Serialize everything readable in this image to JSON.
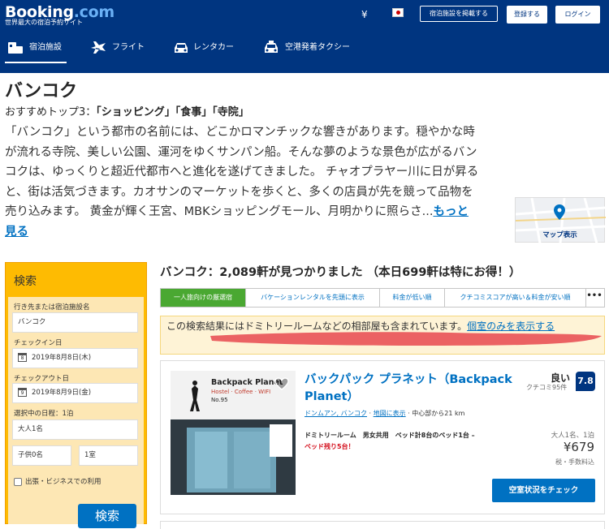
{
  "header": {
    "logo_main": "Booking",
    "logo_suffix": ".com",
    "tagline": "世界最大の宿泊予約サイト",
    "currency": "¥",
    "list_property_label": "宿泊施設を掲載する",
    "register_label": "登録する",
    "login_label": "ログイン",
    "nav": [
      {
        "label": "宿泊施設",
        "icon": "bed-icon",
        "active": true
      },
      {
        "label": "フライト",
        "icon": "plane-icon",
        "active": false
      },
      {
        "label": "レンタカー",
        "icon": "car-icon",
        "active": false
      },
      {
        "label": "空港発着タクシー",
        "icon": "taxi-icon",
        "active": false
      }
    ]
  },
  "intro": {
    "city": "バンコク",
    "top3_prefix": "おすすめトップ3：",
    "top3_items": "「ショッピング」「食事」「寺院」",
    "description": "「バンコク」という都市の名前には、どこかロマンチックな響きがあります。穏やかな時が流れる寺院、美しい公園、運河をゆくサンパン船。そんな夢のような景色が広がるバンコクは、ゆっくりと超近代都市へと進化を遂げてきました。 チャオプラヤー川に日が昇ると、街は活気づきます。カオサンのマーケットを歩くと、多くの店員が先を競って品物を売り込みます。 黄金が輝く王宮、MBKショッピングモール、月明かりに照らさ...",
    "more_link": "もっと見る",
    "map_label": "マップ表示"
  },
  "search": {
    "title": "検索",
    "destination_label": "行き先または宿泊施設名",
    "destination_value": "バンコク",
    "checkin_label": "チェックイン日",
    "checkin_day": "8",
    "checkin_value": "2019年8月8日(木)",
    "checkout_label": "チェックアウト日",
    "checkout_day": "9",
    "checkout_value": "2019年8月9日(金)",
    "nights_label": "選択中の日程：1泊",
    "adults_value": "大人1名",
    "children_value": "子供0名",
    "rooms_value": "1室",
    "business_label": "出張・ビジネスでの利用",
    "submit_label": "検索"
  },
  "results": {
    "title": "バンコク：2,089軒が見つかりました （本日699軒は特にお得！）",
    "tabs": [
      {
        "label": "一人旅向けの厳選宿",
        "active": true
      },
      {
        "label": "バケーションレンタルを先頭に表示",
        "active": false
      },
      {
        "label": "料金が低い順",
        "active": false
      },
      {
        "label": "クチコミスコアが高い＆料金が安い順",
        "active": false
      }
    ],
    "tabs_more": "•••",
    "notice_text": "この検索結果にはドミトリールームなどの相部屋も含まれています。",
    "notice_link": "個室のみを表示する",
    "highlight_color": "#e8484f"
  },
  "hotel": {
    "name": "バックパック プラネット（Backpack Planet）",
    "area_link": "ドンムアン, バンコク",
    "map_link": "地図に表示",
    "distance": "中心部から21 km",
    "score_word": "良い",
    "reviews": "クチコミ95件",
    "score": "7.8",
    "room": "ドミトリールーム　男女共用　ベッド計8台のベッド1台 –",
    "left": "ベッド残り5台！",
    "guests": "大人1名、1泊",
    "price": "¥679",
    "tax": "税・手数料込",
    "availability_label": "空室状況をチェック",
    "photo_sign_line1": "Backpack Planet",
    "photo_sign_line2": "Hostel · Coffee · WIFI",
    "photo_sign_line3": "No.95"
  }
}
